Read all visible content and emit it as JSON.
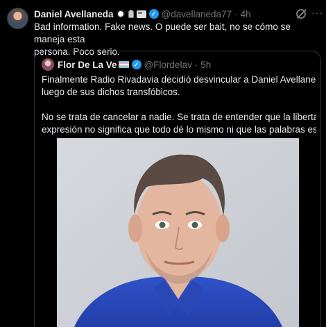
{
  "tweet": {
    "author_name": "Daniel Avellaneda",
    "handle": "@davellaneda77",
    "separator": "·",
    "time": "4h",
    "more": "···",
    "text_lines": [
      "Bad information. Fake news. O puede ser bait, no se cómo se maneja esta",
      "persona. Poco serio."
    ]
  },
  "quote": {
    "author_name": "Flor De La Ve",
    "handle": "@Flordelav",
    "separator": "·",
    "time": "5h",
    "lines": [
      "Finalmente Radio Rivadavia decidió desvincular a Daniel Avellaneda",
      "luego de sus dichos transfóbicos.",
      "",
      "No se trata de cancelar a nadie. Se trata de entender que la libertad de",
      "expresión no significa que todo dé lo mismo ni que las palabras estén ..."
    ]
  },
  "colors": {
    "background": "#000000",
    "text": "#e7e9ea",
    "muted": "#71767b",
    "verified": "#1d9bf0",
    "border": "#2f3336"
  }
}
